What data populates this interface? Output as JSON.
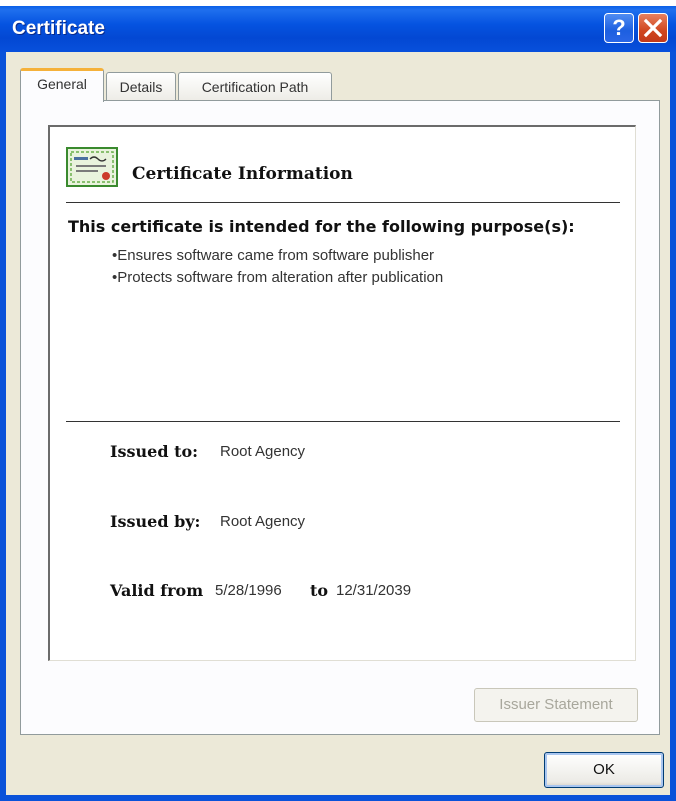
{
  "window": {
    "title": "Certificate"
  },
  "title_buttons": {
    "help_glyph": "?"
  },
  "tabs": [
    {
      "label": "General",
      "active": true
    },
    {
      "label": "Details",
      "active": false
    },
    {
      "label": "Certification Path",
      "active": false
    }
  ],
  "info": {
    "title": "Certificate Information",
    "purpose_heading": "This certificate is intended for the following purpose(s):",
    "purposes": [
      "•Ensures software came from software publisher",
      "•Protects software from alteration after publication"
    ],
    "issued_to_label": "Issued to:",
    "issued_to_value": "Root Agency",
    "issued_by_label": "Issued by:",
    "issued_by_value": "Root Agency",
    "valid_from_label": "Valid from",
    "valid_from_value": "5/28/1996",
    "valid_to_label": "to",
    "valid_to_value": "12/31/2039"
  },
  "buttons": {
    "issuer_statement": "Issuer Statement",
    "ok": "OK"
  },
  "colors": {
    "titlebar": "#0553e0",
    "dialog_face": "#ece9d8",
    "active_tab_accent": "#f5b13a",
    "close_button": "#d0461f"
  },
  "icons": [
    "help-icon",
    "close-icon",
    "certificate-icon"
  ]
}
